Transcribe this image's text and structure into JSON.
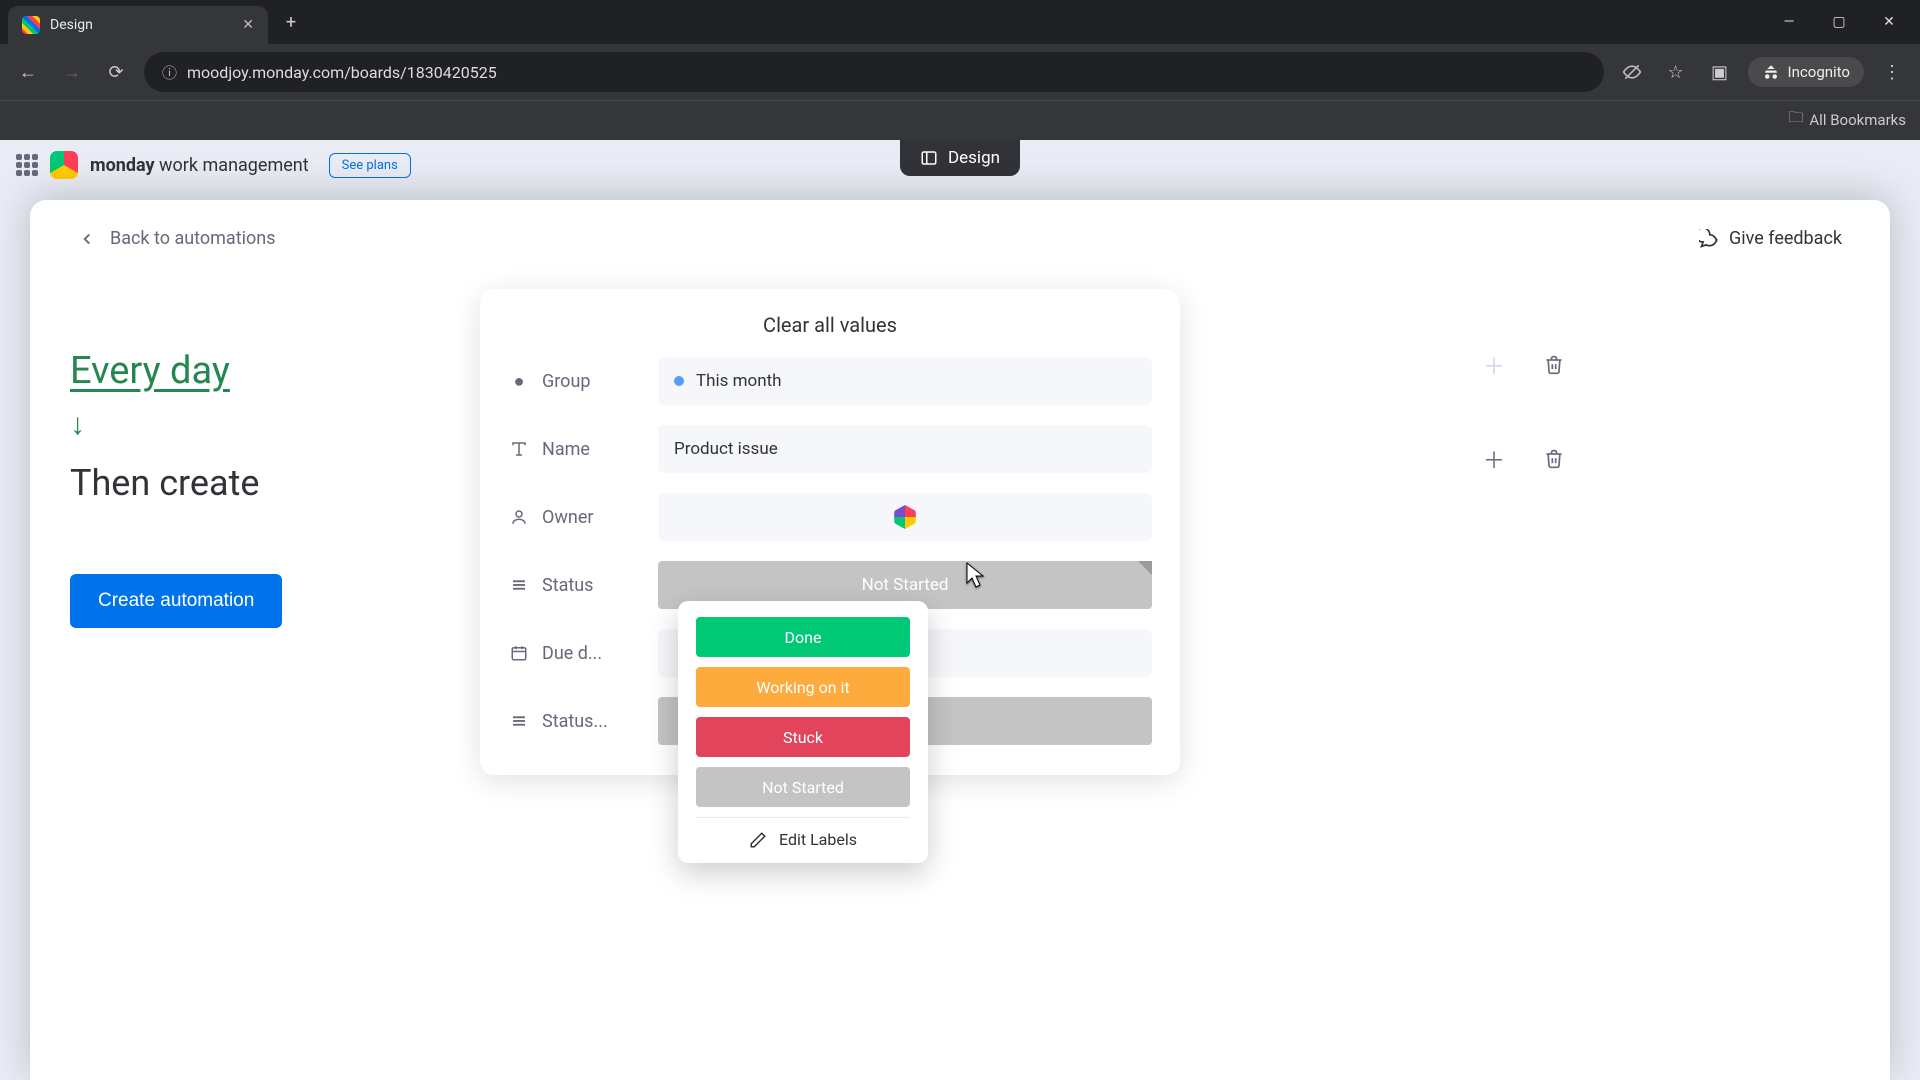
{
  "browser": {
    "tab_title": "Design",
    "url": "moodjoy.monday.com/boards/1830420525",
    "incognito_label": "Incognito",
    "all_bookmarks_label": "All Bookmarks"
  },
  "backdrop": {
    "brand_bold": "monday",
    "brand_rest": "work management",
    "see_plans": "See plans",
    "page_chip": "Design"
  },
  "modal": {
    "back_label": "Back to automations",
    "feedback_label": "Give feedback"
  },
  "builder": {
    "trigger": "Every day",
    "then_create": "Then create",
    "create_button": "Create automation"
  },
  "values_card": {
    "clear_all": "Clear all values",
    "fields": {
      "group": {
        "label": "Group",
        "value": "This month"
      },
      "name": {
        "label": "Name",
        "value": "Product issue"
      },
      "owner": {
        "label": "Owner"
      },
      "status": {
        "label": "Status",
        "value": "Not Started"
      },
      "due_date": {
        "label": "Due d..."
      },
      "status2": {
        "label": "Status..."
      }
    }
  },
  "status_dropdown": {
    "options": [
      "Done",
      "Working on it",
      "Stuck",
      "Not Started"
    ],
    "edit_labels": "Edit Labels"
  },
  "colors": {
    "done": "#00C875",
    "working": "#FDAB3D",
    "stuck": "#E2445C",
    "not_started": "#c4c4c4",
    "primary": "#0073EA"
  }
}
